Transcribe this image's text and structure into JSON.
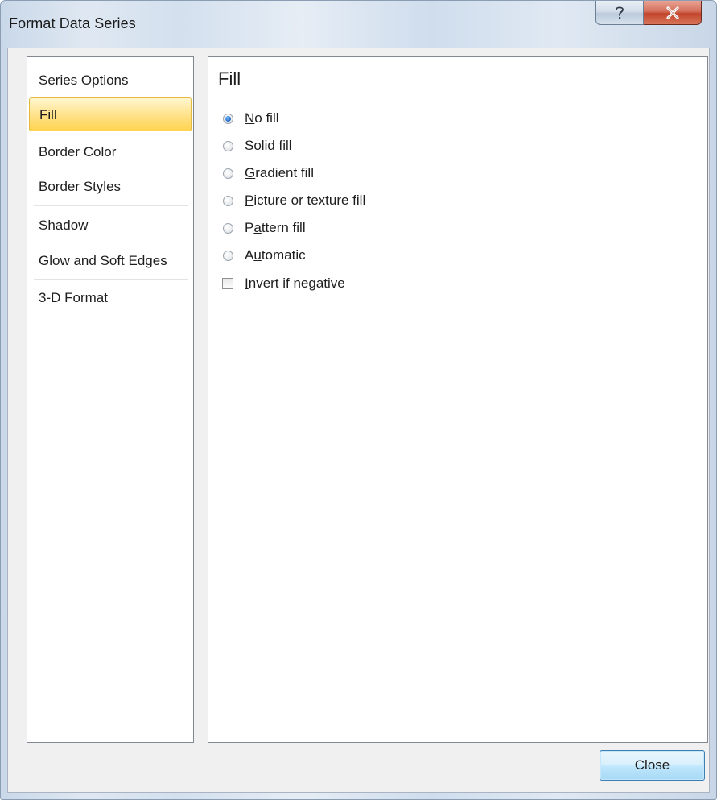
{
  "window": {
    "title": "Format Data Series",
    "help_icon": "question-mark-icon",
    "close_icon": "close-x-icon"
  },
  "nav": {
    "items": [
      {
        "label": "Series Options",
        "selected": false
      },
      {
        "label": "Fill",
        "selected": true
      },
      {
        "label": "Border Color",
        "selected": false
      },
      {
        "label": "Border Styles",
        "selected": false
      },
      {
        "label": "Shadow",
        "selected": false
      },
      {
        "label": "Glow and Soft Edges",
        "selected": false
      },
      {
        "label": "3-D Format",
        "selected": false
      }
    ]
  },
  "panel": {
    "title": "Fill",
    "options": [
      {
        "label": "No fill",
        "accel": "N",
        "checked": true
      },
      {
        "label": "Solid fill",
        "accel": "S",
        "checked": false
      },
      {
        "label": "Gradient fill",
        "accel": "G",
        "checked": false
      },
      {
        "label": "Picture or texture fill",
        "accel": "P",
        "checked": false
      },
      {
        "label": "Pattern fill",
        "accel": "a",
        "checked": false
      },
      {
        "label": "Automatic",
        "accel": "u",
        "checked": false
      }
    ],
    "invert": {
      "label": "Invert if negative",
      "accel": "I",
      "checked": false
    }
  },
  "footer": {
    "close_label": "Close"
  },
  "colors": {
    "selection_fill": "#ffd451",
    "selection_border": "#e3b93f",
    "radio_dot": "#2a6fc9",
    "close_caption": "#c2452b"
  }
}
